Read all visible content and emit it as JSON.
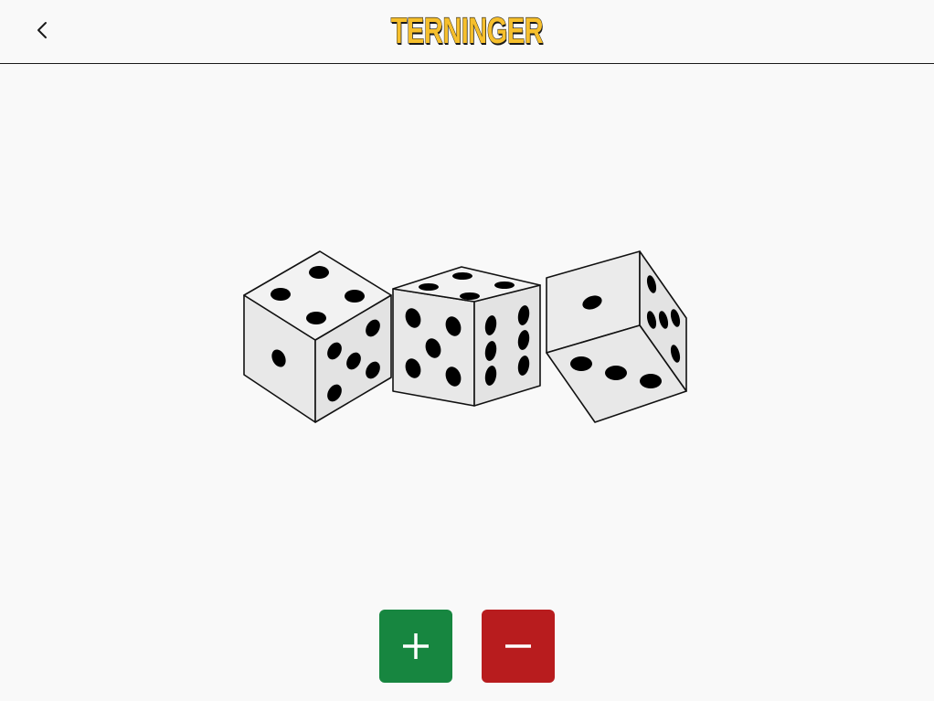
{
  "header": {
    "title": "TERNINGER",
    "back_icon": "chevron-left-icon"
  },
  "dice": {
    "count": 3,
    "face_color": "#e6e6e6",
    "top_color": "#f2f2f2",
    "pip_color": "#000000"
  },
  "controls": {
    "add": {
      "icon": "plus-icon",
      "color": "#178640"
    },
    "remove": {
      "icon": "minus-icon",
      "color": "#b81c1e"
    }
  },
  "colors": {
    "title": "#f6bf2c",
    "background": "#f9f9f9"
  }
}
